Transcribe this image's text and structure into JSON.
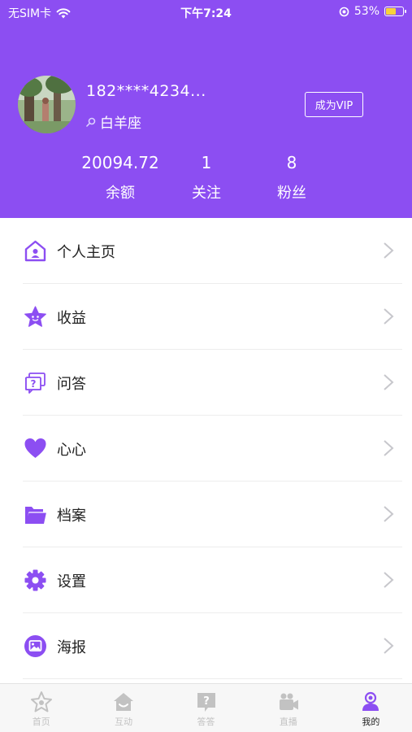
{
  "status_bar": {
    "carrier": "无SIM卡",
    "time": "下午7:24",
    "battery": "53%",
    "battery_level": 0.53
  },
  "profile": {
    "username": "182****4234...",
    "zodiac": "白羊座",
    "vip_button": "成为VIP"
  },
  "stats": [
    {
      "value": "20094.72",
      "label": "余额"
    },
    {
      "value": "1",
      "label": "关注"
    },
    {
      "value": "8",
      "label": "粉丝"
    }
  ],
  "menu": [
    {
      "label": "个人主页",
      "icon": "home-icon"
    },
    {
      "label": "收益",
      "icon": "star-icon"
    },
    {
      "label": "问答",
      "icon": "question-chat-icon"
    },
    {
      "label": "心心",
      "icon": "heart-icon"
    },
    {
      "label": "档案",
      "icon": "folder-icon"
    },
    {
      "label": "设置",
      "icon": "gear-icon"
    },
    {
      "label": "海报",
      "icon": "poster-icon"
    }
  ],
  "tabbar": [
    {
      "label": "首页",
      "icon": "star-home-icon",
      "active": false
    },
    {
      "label": "互动",
      "icon": "house-icon",
      "active": false
    },
    {
      "label": "答答",
      "icon": "question-icon",
      "active": false
    },
    {
      "label": "直播",
      "icon": "video-icon",
      "active": false
    },
    {
      "label": "我的",
      "icon": "user-icon",
      "active": true
    }
  ],
  "colors": {
    "primary": "#8c4ef2",
    "battery_fill": "#f7d23b",
    "tab_inactive": "#c2c2c2"
  }
}
